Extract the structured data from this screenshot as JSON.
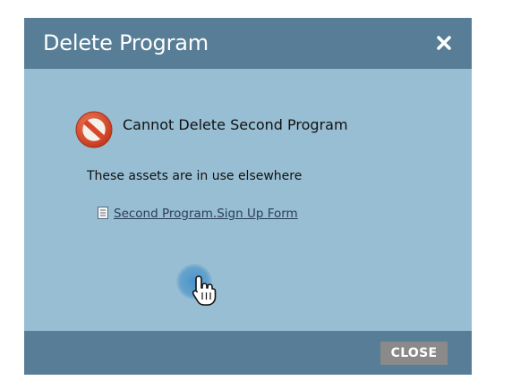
{
  "dialog": {
    "title": "Delete Program",
    "heading": "Cannot Delete Second Program",
    "description": "These assets are in use elsewhere",
    "assets": [
      {
        "icon": "form-document-icon",
        "label": "Second Program.Sign Up Form"
      }
    ],
    "close_icon": "close-icon",
    "status_icon": "prohibited-icon",
    "footer": {
      "close_label": "CLOSE"
    }
  },
  "colors": {
    "titlebar": "#577e96",
    "body": "#98bed3",
    "footer": "#577e96",
    "close_button": "#8a8a8a",
    "stop_icon": "#d9472b"
  }
}
